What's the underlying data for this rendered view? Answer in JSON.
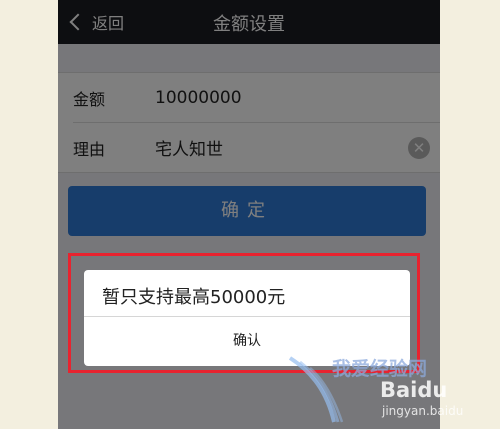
{
  "navbar": {
    "back_label": "返回",
    "title": "金额设置"
  },
  "form": {
    "amount_label": "金额",
    "amount_value": "10000000",
    "reason_label": "理由",
    "reason_value": "宅人知世",
    "clear_glyph": "✕"
  },
  "confirm_button_label": "确定",
  "dialog": {
    "message": "暂只支持最高50000元",
    "confirm_label": "确认"
  },
  "watermark": {
    "text": "我爱经验网",
    "brand": "Baidu",
    "url": "jingyan.baidu"
  },
  "colors": {
    "navbar": "#1b1c22",
    "primary_button": "#2f7bd6",
    "highlight_border": "#e8232f",
    "page_side": "#f3efdf"
  }
}
